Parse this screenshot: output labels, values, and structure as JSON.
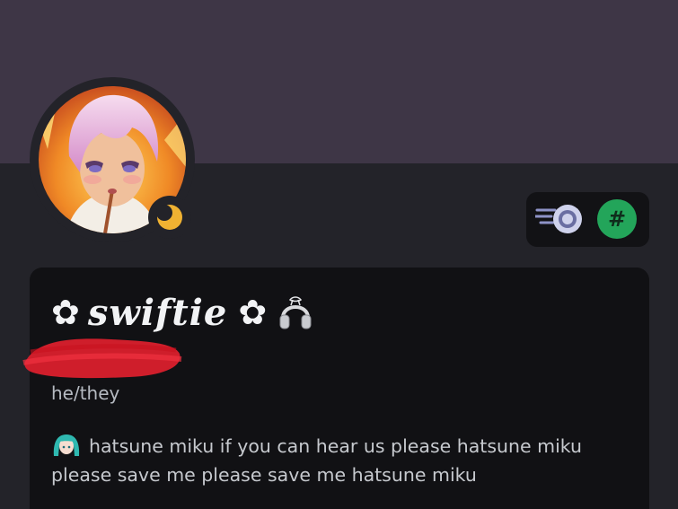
{
  "profile": {
    "display_name": "swiftie",
    "name_decoration_left": "✿",
    "name_decoration_right": "✿",
    "pronouns": "he/they",
    "bio": "hatsune miku if you can hear us please hatsune miku please save me please save me hatsune miku",
    "status": "idle"
  },
  "icons": {
    "status": "moon-icon",
    "badge_1": "nitro-badge-icon",
    "badge_2": "hashtag-badge-icon",
    "name_emoji": "headphones-icon",
    "bio_emoji": "hatsune-miku-emoji-icon"
  },
  "colors": {
    "banner": "#3e3646",
    "background": "#232329",
    "card": "#111114",
    "idle_status": "#f0b232",
    "hashtag_badge": "#23a55a",
    "redaction": "#e0202e"
  }
}
